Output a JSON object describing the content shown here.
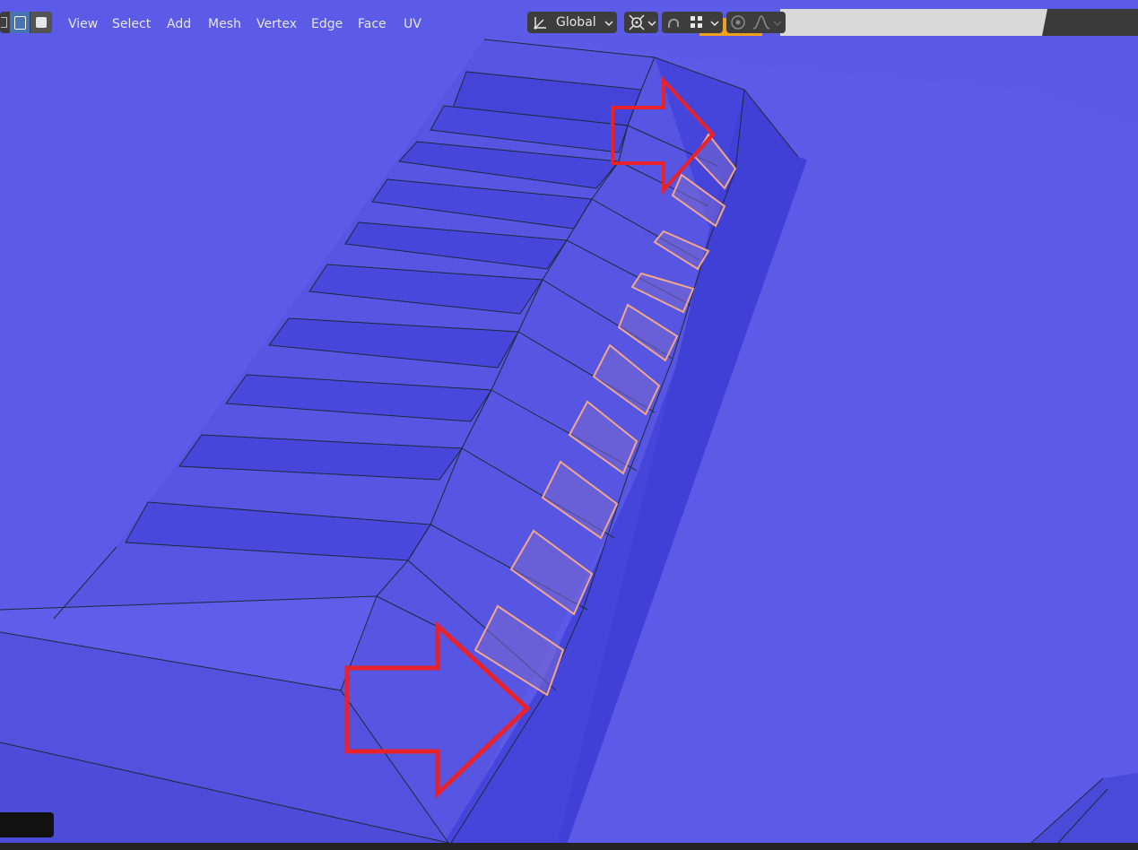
{
  "header": {
    "menus": [
      {
        "label": "View"
      },
      {
        "label": "Select"
      },
      {
        "label": "Add"
      },
      {
        "label": "Mesh"
      },
      {
        "label": "Vertex"
      },
      {
        "label": "Edge"
      },
      {
        "label": "Face"
      },
      {
        "label": "UV"
      }
    ],
    "transform_orientation": "Global",
    "select_modes": [
      "vertex-select-icon",
      "edge-select-icon",
      "face-select-icon"
    ],
    "active_select_mode": "edge"
  },
  "colors": {
    "mesh_face": "#5a5ae6",
    "mesh_face_dark": "#4848dd",
    "edge_wire": "#1a2a3a",
    "selection_highlight": "#f2a68c",
    "annotation_arrow": "#e8222a",
    "header_bg": "#303030"
  },
  "annotations": [
    {
      "type": "arrow",
      "direction": "right",
      "name": "upper-arrow"
    },
    {
      "type": "arrow",
      "direction": "right",
      "name": "lower-arrow"
    }
  ]
}
